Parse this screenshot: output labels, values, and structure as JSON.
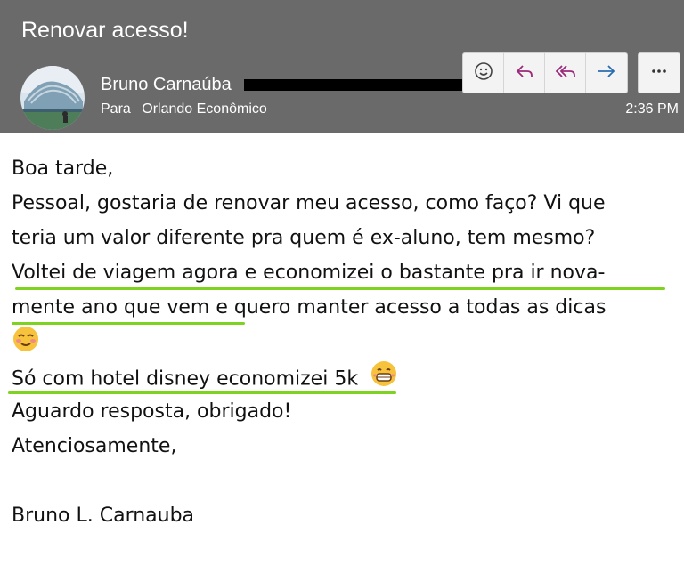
{
  "email": {
    "subject": "Renovar acesso!",
    "sender_name": "Bruno Carnaúba",
    "to_label": "Para",
    "to_name": "Orlando Econômico",
    "time": "2:36 PM"
  },
  "actions": {
    "icons": [
      "emoji-icon",
      "reply-icon",
      "reply-all-icon",
      "forward-icon",
      "more-icon"
    ]
  },
  "body": {
    "lines": [
      "Boa tarde,",
      "Pessoal, gostaria de renovar meu acesso, como faço? Vi que",
      "teria um valor diferente pra quem é ex-aluno, tem mesmo?",
      "Voltei de viagem agora e economizei o bastante pra ir nova-",
      "mente ano que vem e quero manter acesso a todas as dicas",
      "",
      "Só com hotel disney economizei 5k",
      "Aguardo resposta, obrigado!",
      "Atenciosamente,",
      "",
      "Bruno L. Carnauba"
    ]
  },
  "colors": {
    "header_bg": "#6a6a6a",
    "highlight": "#7ed321",
    "accent_purple": "#9c2a7a",
    "accent_blue": "#2b6cb0"
  }
}
